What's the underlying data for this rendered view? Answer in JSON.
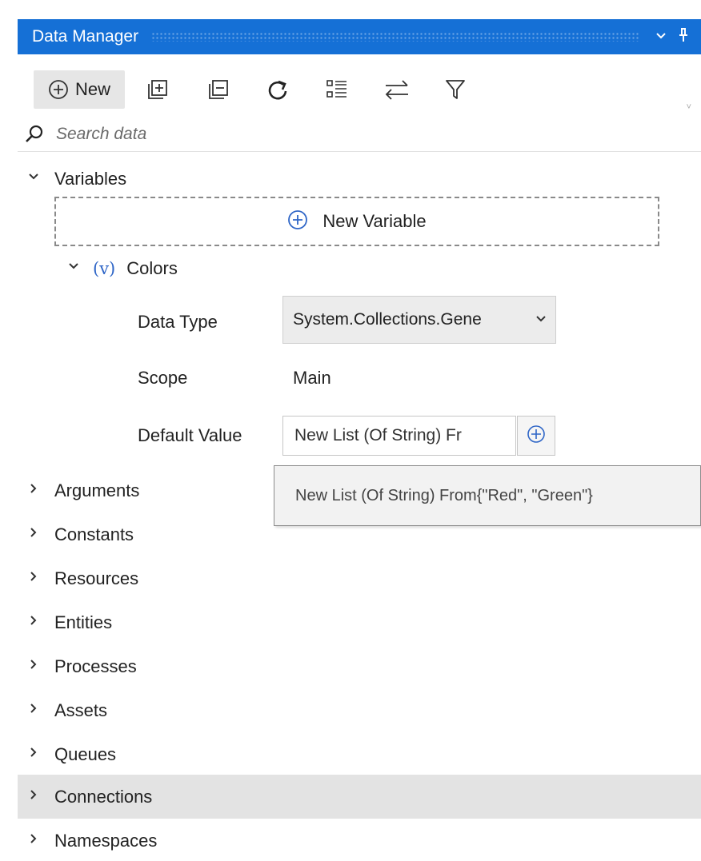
{
  "window": {
    "title": "Data Manager",
    "controls": [
      "chevron-down-icon",
      "pin-icon"
    ]
  },
  "toolbar": {
    "new_label": "New",
    "icons": [
      "add-circle-icon",
      "expand-all-icon",
      "collapse-all-icon",
      "refresh-icon",
      "list-view-icon",
      "swap-icon",
      "filter-icon"
    ]
  },
  "search": {
    "placeholder": "Search data"
  },
  "tree": {
    "variables": {
      "label": "Variables",
      "new_variable_label": "New Variable",
      "variable": {
        "symbol": "(v)",
        "name": "Colors",
        "properties": {
          "data_type_label": "Data Type",
          "data_type_value": "System.Collections.Gene",
          "scope_label": "Scope",
          "scope_value": "Main",
          "default_value_label": "Default Value",
          "default_value_text": "New List (Of String) Fr"
        }
      }
    },
    "tooltip": "New List (Of String) From{\"Red\", \"Green\"}",
    "sections": [
      {
        "label": "Arguments"
      },
      {
        "label": "Constants"
      },
      {
        "label": "Resources"
      },
      {
        "label": "Entities"
      },
      {
        "label": "Processes"
      },
      {
        "label": "Assets"
      },
      {
        "label": "Queues"
      },
      {
        "label": "Connections"
      },
      {
        "label": "Namespaces"
      }
    ],
    "highlighted_section": "Connections"
  },
  "colors": {
    "title_bar": "#1570d6",
    "accent": "#2f66c7",
    "highlight_row": "#e3e3e3"
  }
}
